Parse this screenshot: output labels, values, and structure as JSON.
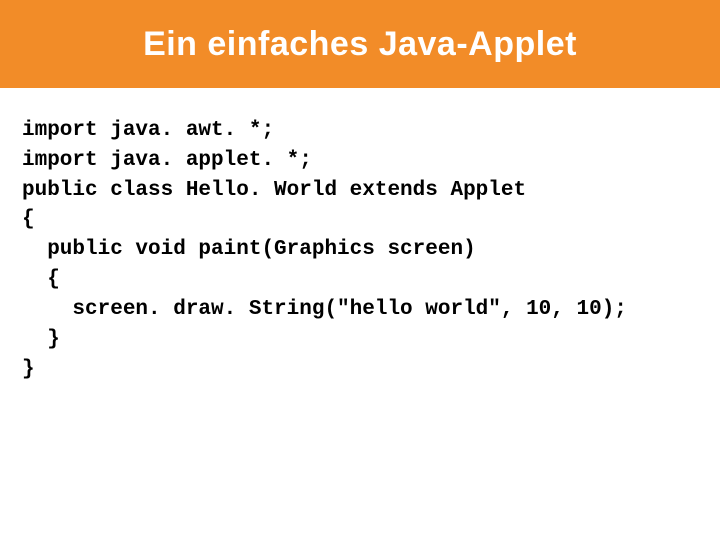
{
  "header": {
    "title": "Ein einfaches Java-Applet"
  },
  "code": {
    "line1": "import java. awt. *;",
    "line2": "import java. applet. *;",
    "line3": "public class Hello. World extends Applet",
    "line4": "{",
    "line5": "  public void paint(Graphics screen)",
    "line6": "  {",
    "line7": "    screen. draw. String(\"hello world\", 10, 10);",
    "line8": "  }",
    "line9": "}"
  }
}
